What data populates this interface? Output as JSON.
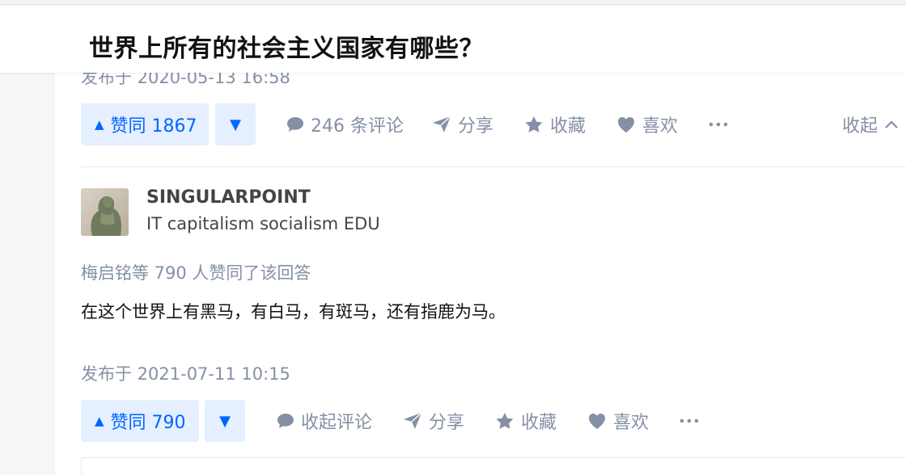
{
  "question": {
    "title": "世界上所有的社会主义国家有哪些？"
  },
  "answer1": {
    "published": "发布于 2020-05-13 16:58",
    "actions": {
      "upvote_label": "赞同 1867",
      "comments": "246 条评论",
      "share": "分享",
      "favorite": "收藏",
      "like": "喜欢",
      "collapse": "收起"
    }
  },
  "answer2": {
    "author": {
      "name": "SINGULARPOINT",
      "bio": "IT capitalism socialism EDU"
    },
    "voters": "梅启铭等 790 人赞同了该回答",
    "content": "在这个世界上有黑马，有白马，有斑马，还有指鹿为马。",
    "published": "发布于 2021-07-11 10:15",
    "actions": {
      "upvote_label": "赞同 790",
      "comments": "收起评论",
      "share": "分享",
      "favorite": "收藏",
      "like": "喜欢"
    }
  },
  "icons": {
    "upvote": "triangle-up-icon",
    "downvote": "triangle-down-icon",
    "comment": "comment-bubble-icon",
    "share": "paper-plane-icon",
    "favorite": "star-icon",
    "like": "heart-icon",
    "more": "more-dots-icon",
    "collapse": "chevron-up-icon"
  },
  "colors": {
    "accent": "#0066ff",
    "accent_bg": "#e5efff",
    "meta_text": "#8590a6",
    "primary_text": "#121212"
  }
}
